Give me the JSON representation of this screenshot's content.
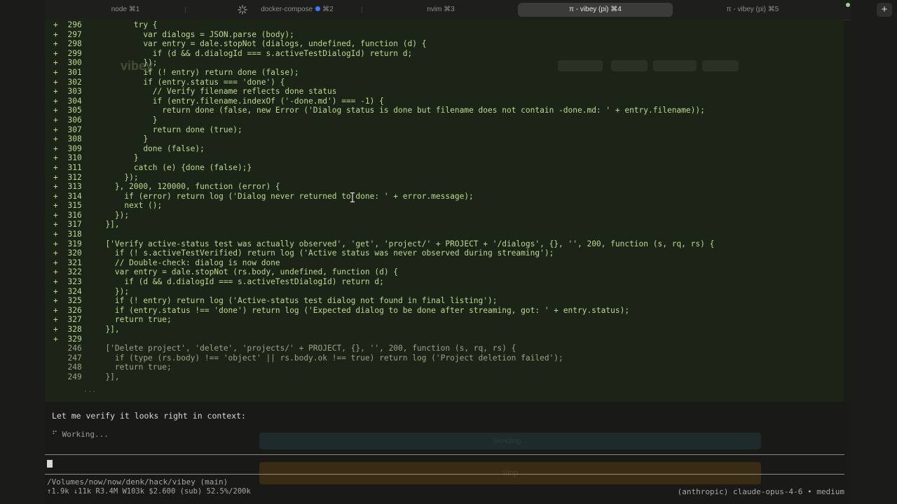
{
  "tabs": [
    {
      "label": "node ⌘1",
      "active": false
    },
    {
      "label": "docker-compose",
      "shortcut": "⌘2",
      "active": false,
      "indicator": "blue-dot"
    },
    {
      "label": "nvim ⌘3",
      "active": false
    },
    {
      "label": "π - vibey (pi) ⌘4",
      "active": true
    },
    {
      "label": "π - vibey (pi) ⌘5",
      "active": false
    }
  ],
  "new_tab_label": "+",
  "code_lines": [
    {
      "marker": "+",
      "num": "296",
      "indent": 6,
      "text": "try {"
    },
    {
      "marker": "+",
      "num": "297",
      "indent": 8,
      "text": "var dialogs = JSON.parse (body);"
    },
    {
      "marker": "+",
      "num": "298",
      "indent": 8,
      "text": "var entry = dale.stopNot (dialogs, undefined, function (d) {"
    },
    {
      "marker": "+",
      "num": "299",
      "indent": 10,
      "text": "if (d && d.dialogId === s.activeTestDialogId) return d;"
    },
    {
      "marker": "+",
      "num": "300",
      "indent": 8,
      "text": "});"
    },
    {
      "marker": "+",
      "num": "301",
      "indent": 8,
      "text": "if (! entry) return done (false);"
    },
    {
      "marker": "+",
      "num": "302",
      "indent": 8,
      "text": "if (entry.status === 'done') {"
    },
    {
      "marker": "+",
      "num": "303",
      "indent": 10,
      "text": "// Verify filename reflects done status"
    },
    {
      "marker": "+",
      "num": "304",
      "indent": 10,
      "text": "if (entry.filename.indexOf ('-done.md') === -1) {"
    },
    {
      "marker": "+",
      "num": "305",
      "indent": 12,
      "text": "return done (false, new Error ('Dialog status is done but filename does not contain -done.md: ' + entry.filename));"
    },
    {
      "marker": "+",
      "num": "306",
      "indent": 10,
      "text": "}"
    },
    {
      "marker": "+",
      "num": "307",
      "indent": 10,
      "text": "return done (true);"
    },
    {
      "marker": "+",
      "num": "308",
      "indent": 8,
      "text": "}"
    },
    {
      "marker": "+",
      "num": "309",
      "indent": 8,
      "text": "done (false);"
    },
    {
      "marker": "+",
      "num": "310",
      "indent": 6,
      "text": "}"
    },
    {
      "marker": "+",
      "num": "311",
      "indent": 6,
      "text": "catch (e) {done (false);}"
    },
    {
      "marker": "+",
      "num": "312",
      "indent": 4,
      "text": "});"
    },
    {
      "marker": "+",
      "num": "313",
      "indent": 2,
      "text": "}, 2000, 120000, function (error) {"
    },
    {
      "marker": "+",
      "num": "314",
      "indent": 4,
      "text": "if (error) return log ('Dialog never returned to done: ' + error.message);"
    },
    {
      "marker": "+",
      "num": "315",
      "indent": 4,
      "text": "next ();"
    },
    {
      "marker": "+",
      "num": "316",
      "indent": 2,
      "text": "});"
    },
    {
      "marker": "+",
      "num": "317",
      "indent": 0,
      "text": "}],"
    },
    {
      "marker": "+",
      "num": "318",
      "indent": 0,
      "text": ""
    },
    {
      "marker": "+",
      "num": "319",
      "indent": 0,
      "text": "['Verify active-status test was actually observed', 'get', 'project/' + PROJECT + '/dialogs', {}, '', 200, function (s, rq, rs) {"
    },
    {
      "marker": "+",
      "num": "320",
      "indent": 2,
      "text": "if (! s.activeTestVerified) return log ('Active status was never observed during streaming');"
    },
    {
      "marker": "+",
      "num": "321",
      "indent": 2,
      "text": "// Double-check: dialog is now done"
    },
    {
      "marker": "+",
      "num": "322",
      "indent": 2,
      "text": "var entry = dale.stopNot (rs.body, undefined, function (d) {"
    },
    {
      "marker": "+",
      "num": "323",
      "indent": 4,
      "text": "if (d && d.dialogId === s.activeTestDialogId) return d;"
    },
    {
      "marker": "+",
      "num": "324",
      "indent": 2,
      "text": "});"
    },
    {
      "marker": "+",
      "num": "325",
      "indent": 2,
      "text": "if (! entry) return log ('Active-status test dialog not found in final listing');"
    },
    {
      "marker": "+",
      "num": "326",
      "indent": 2,
      "text": "if (entry.status !== 'done') return log ('Expected dialog to be done after streaming, got: ' + entry.status);"
    },
    {
      "marker": "+",
      "num": "327",
      "indent": 2,
      "text": "return true;"
    },
    {
      "marker": "+",
      "num": "328",
      "indent": 0,
      "text": "}],"
    },
    {
      "marker": "+",
      "num": "329",
      "indent": 0,
      "text": ""
    },
    {
      "marker": " ",
      "num": "246",
      "indent": 0,
      "text": "['Delete project', 'delete', 'projects/' + PROJECT, {}, '', 200, function (s, rq, rs) {"
    },
    {
      "marker": " ",
      "num": "247",
      "indent": 2,
      "text": "if (type (rs.body) !== 'object' || rs.body.ok !== true) return log ('Project deletion failed');"
    },
    {
      "marker": " ",
      "num": "248",
      "indent": 2,
      "text": "return true;"
    },
    {
      "marker": " ",
      "num": "249",
      "indent": 0,
      "text": "}],"
    }
  ],
  "ellipsis": "...",
  "ghost_ui": {
    "brand": "vibey",
    "buttons": [
      "Sending...",
      "Stop"
    ]
  },
  "assistant_message": "Let me verify it looks right in context:",
  "working_status": "⠋ Working...",
  "footer": {
    "path": "/Volumes/now/now/denk/hack/vibey (main)",
    "stats": "↑1.9k ↓11k R3.4M W103k $2.600 (sub) 52.5%/200k",
    "model": "(anthropic) claude-opus-4-6 • medium"
  },
  "colors": {
    "code_added": "#bfd88f",
    "code_context": "#99a585",
    "panel_bg": "#1c2417",
    "active_tab_bg": "#3b3c39",
    "dot_blue": "#3c7ff5"
  }
}
